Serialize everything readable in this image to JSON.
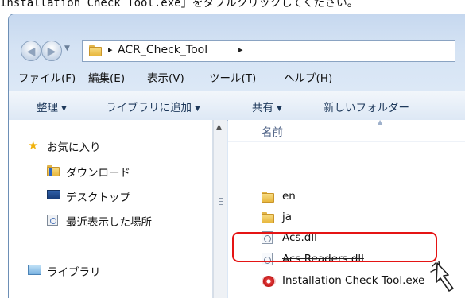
{
  "caption": "Installation Check Tool.exe」をダブルクリックしてください。",
  "address": {
    "path": "ACR_Check_Tool",
    "separator": "▸"
  },
  "menu": [
    {
      "label": "ファイル(",
      "key": "F",
      "end": ")"
    },
    {
      "label": "編集(",
      "key": "E",
      "end": ")"
    },
    {
      "label": "表示(",
      "key": "V",
      "end": ")"
    },
    {
      "label": "ツール(",
      "key": "T",
      "end": ")"
    },
    {
      "label": "ヘルプ(",
      "key": "H",
      "end": ")"
    }
  ],
  "toolbar": [
    {
      "label": "整理"
    },
    {
      "label": "ライブラリに追加"
    },
    {
      "label": "共有"
    },
    {
      "label": "新しいフォルダー"
    }
  ],
  "navigation": {
    "favorites": "お気に入り",
    "items": [
      {
        "label": "ダウンロード",
        "icon": "download-folder-icon"
      },
      {
        "label": "デスクトップ",
        "icon": "desktop-icon"
      },
      {
        "label": "最近表示した場所",
        "icon": "recent-places-icon"
      }
    ],
    "library": "ライブラリ"
  },
  "files": {
    "column_header": "名前",
    "items": [
      {
        "name": "en",
        "type": "folder"
      },
      {
        "name": "ja",
        "type": "folder"
      },
      {
        "name": "Acs.dll",
        "type": "dll"
      },
      {
        "name": "Acs.Readers.dll",
        "type": "dll"
      },
      {
        "name": "Installation Check Tool.exe",
        "type": "exe"
      }
    ]
  },
  "colors": {
    "highlight": "#e51414",
    "chrome": "#d5e3f4"
  }
}
